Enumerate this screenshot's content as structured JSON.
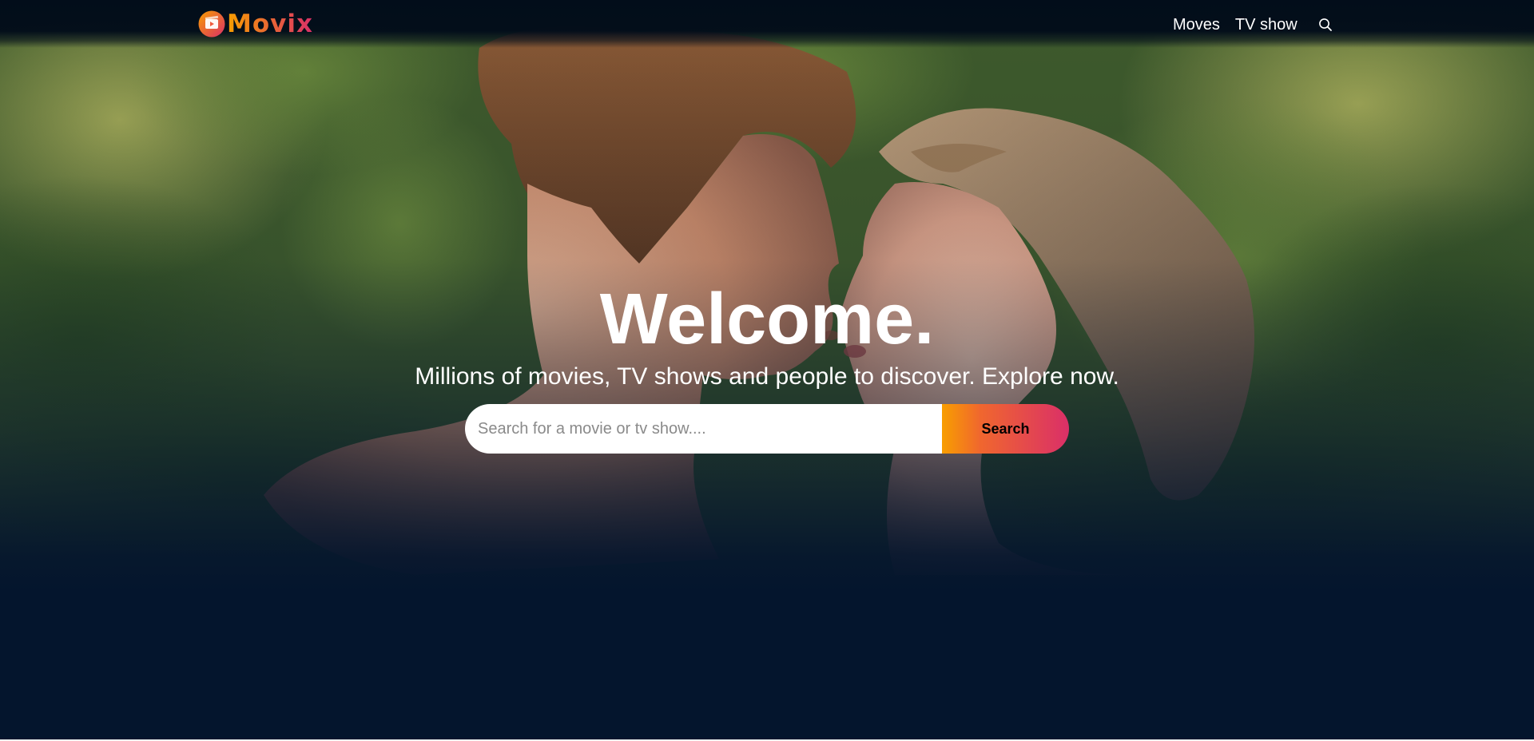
{
  "header": {
    "logo_text": "Movix",
    "nav": [
      {
        "label": "Moves"
      },
      {
        "label": "TV show"
      }
    ],
    "search_icon": "search-icon"
  },
  "hero": {
    "title": "Welcome.",
    "subtitle": "Millions of movies, TV shows and people to discover. Explore now.",
    "search": {
      "placeholder": "Search for a movie or tv show....",
      "value": "",
      "button_label": "Search"
    }
  },
  "colors": {
    "background": "#04152d",
    "header": "#020d1a",
    "accent_orange": "#f89e00",
    "accent_pink": "#da2f68",
    "text": "#ffffff"
  }
}
